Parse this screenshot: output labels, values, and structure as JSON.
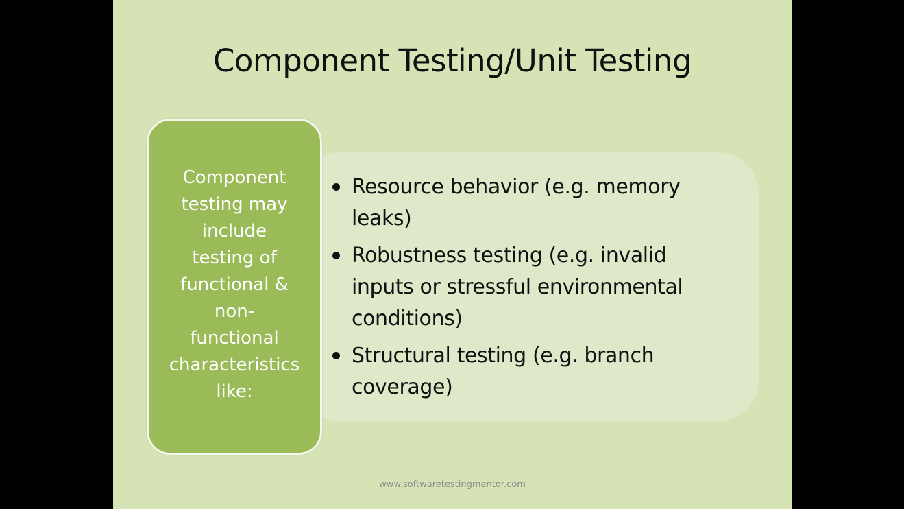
{
  "slide": {
    "title": "Component Testing/Unit Testing",
    "label_box": {
      "lines": [
        "Component",
        "testing may",
        "include",
        "testing of",
        "functional &",
        "non-",
        "functional",
        "characteristics",
        "like:"
      ]
    },
    "bullets": [
      {
        "lines": [
          "Resource behavior (e.g. memory",
          "leaks)"
        ]
      },
      {
        "lines": [
          "Robustness testing (e.g. invalid",
          "inputs or stressful environmental",
          "conditions)"
        ]
      },
      {
        "lines": [
          "Structural testing (e.g. branch",
          "coverage)"
        ]
      }
    ],
    "footer": "www.softwaretestingmentor.com"
  },
  "colors": {
    "letterbox": "#000000",
    "slide_background": "#d6e3b4",
    "label_box_fill": "#9bbb59",
    "label_box_text": "#ffffff",
    "content_panel": "#dfe8c9",
    "text": "#111111",
    "footer_text": "#8c8c8c"
  }
}
